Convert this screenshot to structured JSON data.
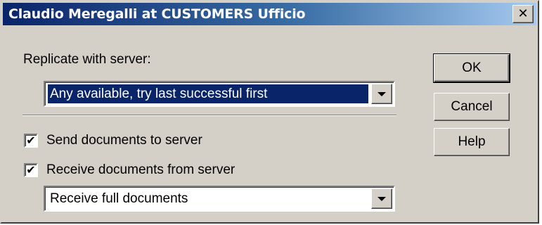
{
  "window": {
    "title": "Claudio Meregalli at CUSTOMERS Ufficio",
    "close_icon": "close-icon",
    "close_glyph": "✕"
  },
  "replicate": {
    "label": "Replicate with server:",
    "selected_value": "Any available, try last successful first"
  },
  "options": {
    "send": {
      "label": "Send documents to server",
      "checked": true
    },
    "receive": {
      "label": "Receive documents from server",
      "checked": true
    }
  },
  "receive_mode": {
    "selected_value": "Receive full documents"
  },
  "buttons": {
    "ok": "OK",
    "cancel": "Cancel",
    "help": "Help"
  },
  "colors": {
    "title_active": "#0a246a",
    "face": "#d4d0c8",
    "selection": "#0a246a"
  }
}
